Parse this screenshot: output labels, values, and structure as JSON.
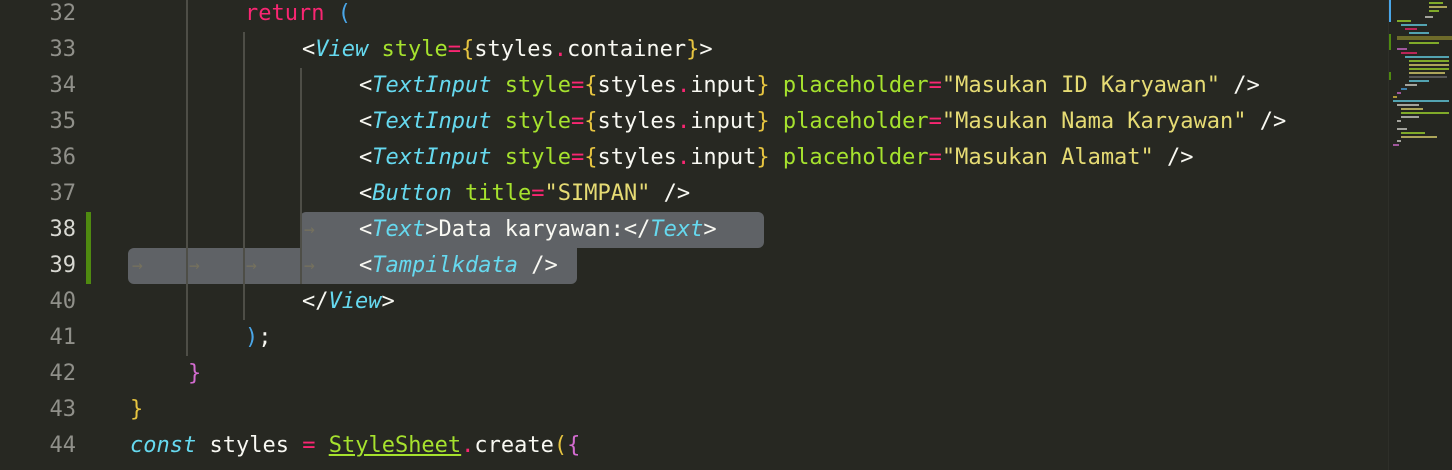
{
  "colors": {
    "background": "#272822",
    "selection": "#5f6266",
    "gutter_modified": "#4f8a10"
  },
  "gutter": {
    "line_numbers": [
      "32",
      "33",
      "34",
      "35",
      "36",
      "37",
      "38",
      "39",
      "40",
      "41",
      "42",
      "43",
      "44"
    ],
    "modified_lines": [
      "38",
      "39"
    ]
  },
  "code": {
    "l32": {
      "return": "return",
      "paren": "("
    },
    "l33": {
      "lt": "<",
      "tag": "View",
      "attr": "style",
      "eq": "=",
      "ob": "{",
      "obj": "styles",
      "dot": ".",
      "prop": "container",
      "cb": "}",
      "gt": ">"
    },
    "l34": {
      "lt": "<",
      "tag": "TextInput",
      "attr": "style",
      "eq": "=",
      "ob": "{",
      "obj": "styles",
      "dot": ".",
      "prop": "input",
      "cb": "}",
      "attr2": "placeholder",
      "eq2": "=",
      "str": "\"Masukan ID Karyawan\"",
      "close": " />"
    },
    "l35": {
      "lt": "<",
      "tag": "TextInput",
      "attr": "style",
      "eq": "=",
      "ob": "{",
      "obj": "styles",
      "dot": ".",
      "prop": "input",
      "cb": "}",
      "attr2": "placeholder",
      "eq2": "=",
      "str": "\"Masukan Nama Karyawan\"",
      "close": " />"
    },
    "l36": {
      "lt": "<",
      "tag": "TextInput",
      "attr": "style",
      "eq": "=",
      "ob": "{",
      "obj": "styles",
      "dot": ".",
      "prop": "input",
      "cb": "}",
      "attr2": "placeholder",
      "eq2": "=",
      "str": "\"Masukan Alamat\"",
      "close": " />"
    },
    "l37": {
      "lt": "<",
      "tag": "Button",
      "attr": "title",
      "eq": "=",
      "str": "\"SIMPAN\"",
      "close": " />"
    },
    "l38": {
      "lt": "<",
      "tag": "Text",
      "gt": ">",
      "text": "Data karyawan:",
      "lt2": "</",
      "tag2": "Text",
      "gt2": ">"
    },
    "l39": {
      "lt": "<",
      "tag": "Tampilkdata",
      "close": " />"
    },
    "l40": {
      "lt": "</",
      "tag": "View",
      "gt": ">"
    },
    "l41": {
      "paren": ")",
      "semi": ";"
    },
    "l42": {
      "brace": "}"
    },
    "l43": {
      "brace": "}"
    },
    "l44": {
      "kw": "const",
      "name": "styles",
      "eq": "=",
      "cls": "StyleSheet",
      "dot": ".",
      "fn": "create",
      "paren": "(",
      "brace": "{"
    }
  },
  "whitespace_arrow": "→"
}
